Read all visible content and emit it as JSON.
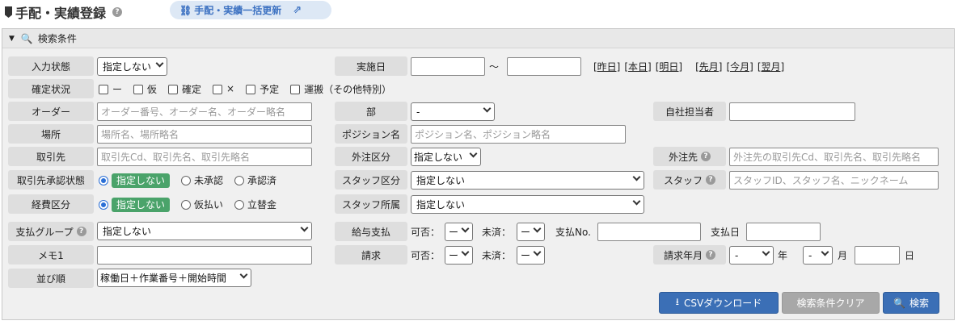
{
  "header": {
    "title": "手配・実績登録",
    "bulk_link": "手配・実績一括更新"
  },
  "panel": {
    "title": "検索条件"
  },
  "labels": {
    "input_status": "入力状態",
    "confirm_status": "確定状況",
    "order": "オーダー",
    "place": "場所",
    "client": "取引先",
    "client_approval": "取引先承認状態",
    "expense": "経費区分",
    "pay_group": "支払グループ",
    "memo": "メモ1",
    "sort": "並び順",
    "date": "実施日",
    "dept": "部",
    "position": "ポジション名",
    "outsource_type": "外注区分",
    "staff_type": "スタッフ区分",
    "staff_affil": "スタッフ所属",
    "salary": "給与支払",
    "billing": "請求",
    "in_charge": "自社担当者",
    "outsource": "外注先",
    "staff": "スタッフ",
    "bill_month": "請求年月"
  },
  "values": {
    "input_status": "指定しない",
    "dept": "-",
    "outsource_type": "指定しない",
    "staff_type": "指定しない",
    "staff_affil": "指定しない",
    "pay_group": "指定しない",
    "sort": "稼働日＋作業番号＋開始時間",
    "salary_ok": "ー",
    "salary_done": "ー",
    "billing_ok": "ー",
    "billing_done": "ー",
    "bill_year": "-",
    "bill_month": "-"
  },
  "placeholders": {
    "order": "オーダー番号、オーダー名、オーダー略名",
    "place": "場所名、場所略名",
    "client": "取引先Cd、取引先名、取引先略名",
    "position": "ポジション名、ポジション略名",
    "outsource": "外注先の取引先Cd、取引先名、取引先略名",
    "staff": "スタッフID、スタッフ名、ニックネーム"
  },
  "date_links": [
    "[昨日]",
    "[本日]",
    "[明日]",
    "[先月]",
    "[今月]",
    "[翌月]"
  ],
  "text": {
    "tilde": "～",
    "ok_label": "可否：",
    "done_label": "未済：",
    "pay_no": "支払No.",
    "pay_date": "支払日",
    "year": "年",
    "month": "月",
    "day": "日"
  },
  "confirm_options": [
    "ー",
    "仮",
    "確定",
    "×",
    "予定",
    "運搬（その他特別）"
  ],
  "approval_options": [
    "指定しない",
    "未承認",
    "承認済"
  ],
  "expense_options": [
    "指定しない",
    "仮払い",
    "立替金"
  ],
  "buttons": {
    "csv": "CSVダウンロード",
    "clear": "検索条件クリア",
    "search": "検索"
  }
}
